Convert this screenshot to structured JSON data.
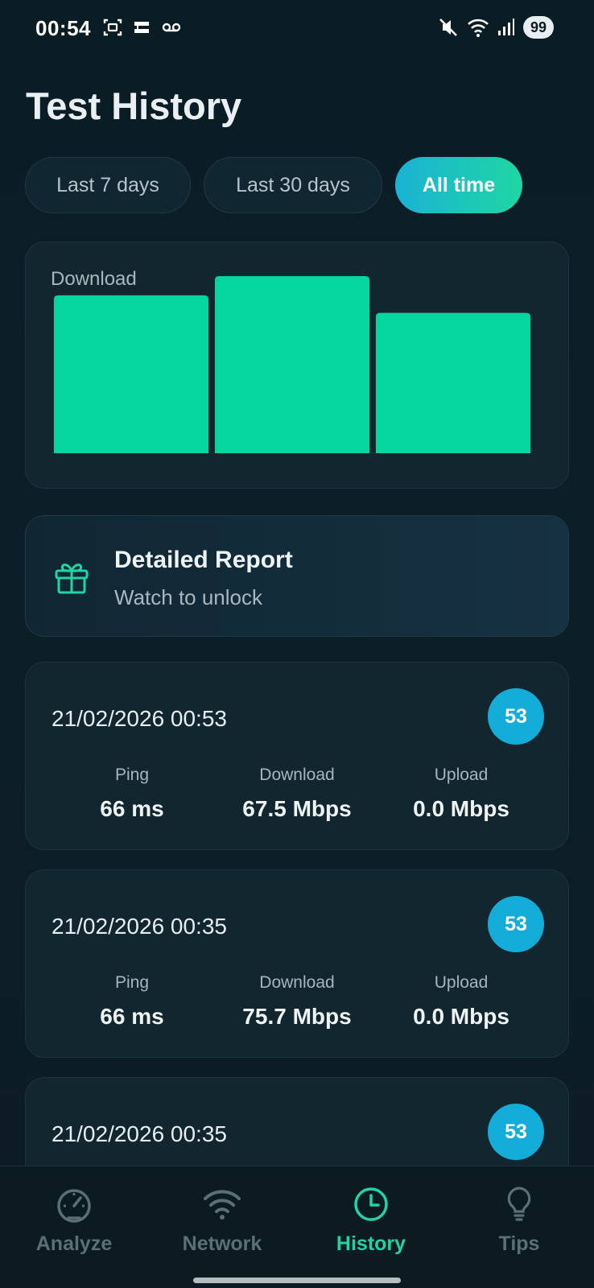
{
  "status_bar": {
    "time": "00:54",
    "battery": "99"
  },
  "page": {
    "title": "Test History"
  },
  "filters": [
    {
      "label": "Last 7 days",
      "selected": false
    },
    {
      "label": "Last 30 days",
      "selected": false
    },
    {
      "label": "All time",
      "selected": true
    }
  ],
  "chart_data": {
    "type": "bar",
    "title": "Download",
    "categories": [
      "",
      "",
      ""
    ],
    "values": [
      67.5,
      75.7,
      60.0
    ],
    "ylim": [
      0,
      75.7
    ],
    "grid": false,
    "bar_color": "#05d69f"
  },
  "report": {
    "title": "Detailed Report",
    "subtitle": "Watch to unlock"
  },
  "metric_labels": {
    "ping": "Ping",
    "download": "Download",
    "upload": "Upload"
  },
  "entries": [
    {
      "date": "21/02/2026 00:53",
      "score": "53",
      "ping": "66 ms",
      "download": "67.5 Mbps",
      "upload": "0.0 Mbps"
    },
    {
      "date": "21/02/2026 00:35",
      "score": "53",
      "ping": "66 ms",
      "download": "75.7 Mbps",
      "upload": "0.0 Mbps"
    },
    {
      "date": "21/02/2026 00:35",
      "score": "53",
      "ping": "",
      "download": "",
      "upload": ""
    }
  ],
  "nav": {
    "items": [
      {
        "label": "Analyze",
        "icon": "speedometer-icon",
        "active": false
      },
      {
        "label": "Network",
        "icon": "wifi-icon",
        "active": false
      },
      {
        "label": "History",
        "icon": "clock-icon",
        "active": true
      },
      {
        "label": "Tips",
        "icon": "lightbulb-icon",
        "active": false
      }
    ]
  },
  "colors": {
    "accent_green": "#22d3a3",
    "accent_blue": "#14acd8",
    "background": "#0c1e27",
    "card": "#12262f"
  }
}
